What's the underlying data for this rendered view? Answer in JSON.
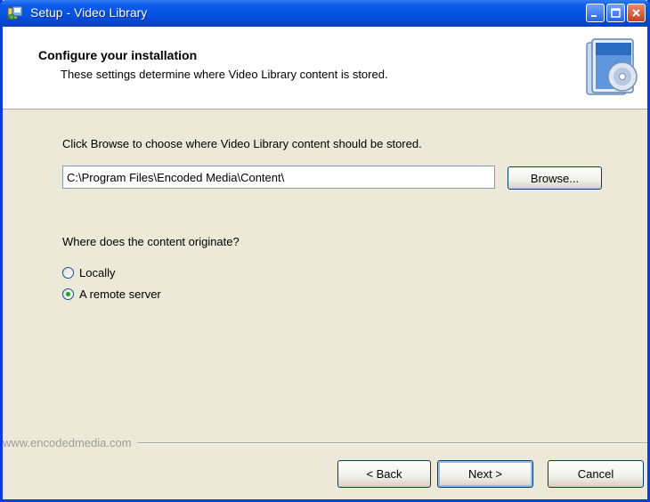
{
  "window": {
    "title": "Setup - Video Library"
  },
  "header": {
    "title": "Configure your installation",
    "subtitle": "These settings determine where Video Library content is stored.",
    "icon": "cd-case-icon"
  },
  "location": {
    "prompt": "Click Browse to choose where Video Library content should be stored.",
    "path_value": "C:\\Program Files\\Encoded Media\\Content\\",
    "browse_label": "Browse..."
  },
  "origin": {
    "question": "Where does the content originate?",
    "options": [
      {
        "label": "Locally",
        "selected": false
      },
      {
        "label": "A remote server",
        "selected": true
      }
    ]
  },
  "footer": {
    "watermark": "www.encodedmedia.com",
    "back_label": "< Back",
    "next_label": "Next >",
    "cancel_label": "Cancel"
  },
  "colors": {
    "titlebar": "#0053E1",
    "dialog_bg": "#ECE9D8",
    "radio_dot": "#21A121"
  }
}
